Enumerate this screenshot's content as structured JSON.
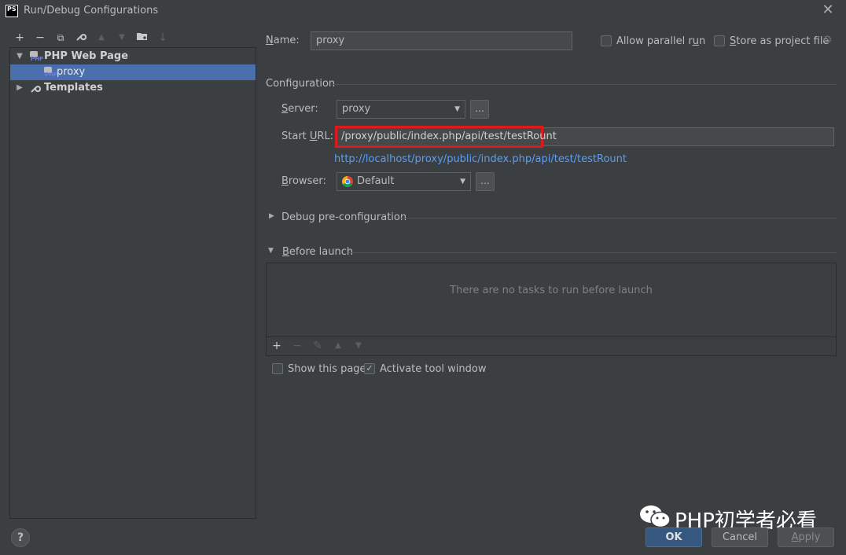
{
  "window": {
    "title": "Run/Debug Configurations",
    "app_icon_text": "PS"
  },
  "toolbar": {
    "add": "+",
    "remove": "−",
    "copy": "⧉",
    "edit": "🔧",
    "move_up": "▲",
    "move_down": "▼",
    "folder": "▇",
    "sort": "↓"
  },
  "tree": {
    "group_label": "PHP Web Page",
    "child_label": "proxy",
    "templates_label": "Templates"
  },
  "form": {
    "name_label_u": "N",
    "name_label_rest": "ame:",
    "name_value": "proxy",
    "allow_parallel_label": "Allow parallel r",
    "allow_parallel_u": "u",
    "allow_parallel_rest": "n",
    "store_label_a": "",
    "store_label_u": "S",
    "store_label_rest": "tore as project file",
    "configuration_header": "Configuration",
    "server_label_u": "S",
    "server_label_rest": "erver:",
    "server_value": "proxy",
    "ellipsis": "...",
    "start_url_label_a": "Start ",
    "start_url_label_u": "U",
    "start_url_label_rest": "RL:",
    "start_url_value": "/proxy/public/index.php/api/test/testRount",
    "url_link": "http://localhost/proxy/public/index.php/api/test/testRount",
    "browser_label_u": "B",
    "browser_label_rest": "rowser:",
    "browser_value": "Default",
    "debug_preconfig": "Debug pre-configuration",
    "before_launch_u": "B",
    "before_launch_rest": "efore launch",
    "no_tasks": "There are no tasks to run before launch",
    "show_page": "Show this page",
    "activate_tool": "Activate tool window"
  },
  "task_toolbar": {
    "add": "+",
    "remove": "−",
    "edit": "✎",
    "up": "▲",
    "down": "▼"
  },
  "buttons": {
    "ok": "OK",
    "cancel": "Cancel",
    "apply_u": "A",
    "apply_rest": "pply",
    "help": "?"
  },
  "watermark": "PHP初学者必看",
  "colors": {
    "selection": "#4b6eaf",
    "link": "#589df6",
    "highlight": "#e0191a",
    "ok_bg": "#365880"
  }
}
